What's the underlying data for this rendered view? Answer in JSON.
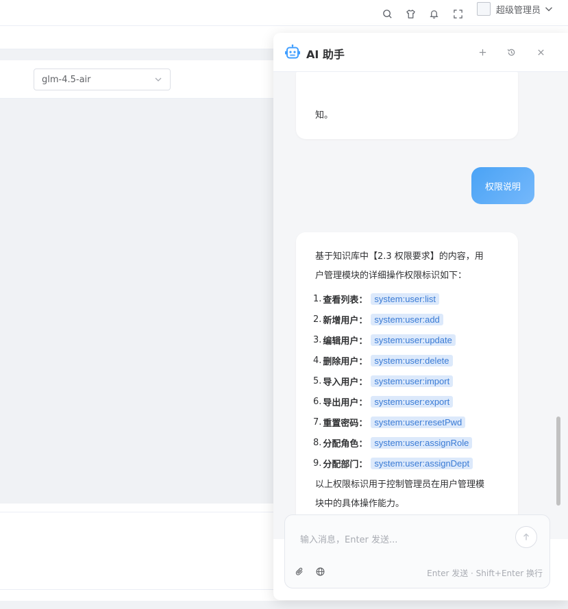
{
  "navbar": {
    "icons": [
      "search-icon",
      "shirt-icon",
      "bell-icon",
      "fullscreen-icon"
    ],
    "username": "超级管理员"
  },
  "model_select": {
    "value": "glm-4.5-air"
  },
  "ai_panel": {
    "title": "AI 助手",
    "header_buttons": [
      "plus-icon",
      "history-icon",
      "close-icon"
    ],
    "prev_message_tail": "知。",
    "user_message": "权限说明",
    "reply": {
      "intro_line1": "基于知识库中【2.3 权限要求】的内容，用",
      "intro_line2": "户管理模块的详细操作权限标识如下：",
      "items": [
        {
          "num": "1.",
          "label": "查看列表：",
          "code": "system:user:list"
        },
        {
          "num": "2.",
          "label": "新增用户：",
          "code": "system:user:add"
        },
        {
          "num": "3.",
          "label": "编辑用户：",
          "code": "system:user:update"
        },
        {
          "num": "4.",
          "label": "删除用户：",
          "code": "system:user:delete"
        },
        {
          "num": "5.",
          "label": "导入用户：",
          "code": "system:user:import"
        },
        {
          "num": "6.",
          "label": "导出用户：",
          "code": "system:user:export"
        },
        {
          "num": "7.",
          "label": "重置密码：",
          "code": "system:user:resetPwd"
        },
        {
          "num": "8.",
          "label": "分配角色：",
          "code": "system:user:assignRole"
        },
        {
          "num": "9.",
          "label": "分配部门：",
          "code": "system:user:assignDept"
        }
      ],
      "outro_line1": "以上权限标识用于控制管理员在用户管理模",
      "outro_line2": "块中的具体操作能力。"
    },
    "input": {
      "placeholder": "输入消息，Enter 发送...",
      "hint": "Enter 发送 · Shift+Enter 换行"
    }
  },
  "colors": {
    "accent": "#409eff",
    "code_bg": "#dce9fb",
    "code_text": "#3a7bd5"
  }
}
